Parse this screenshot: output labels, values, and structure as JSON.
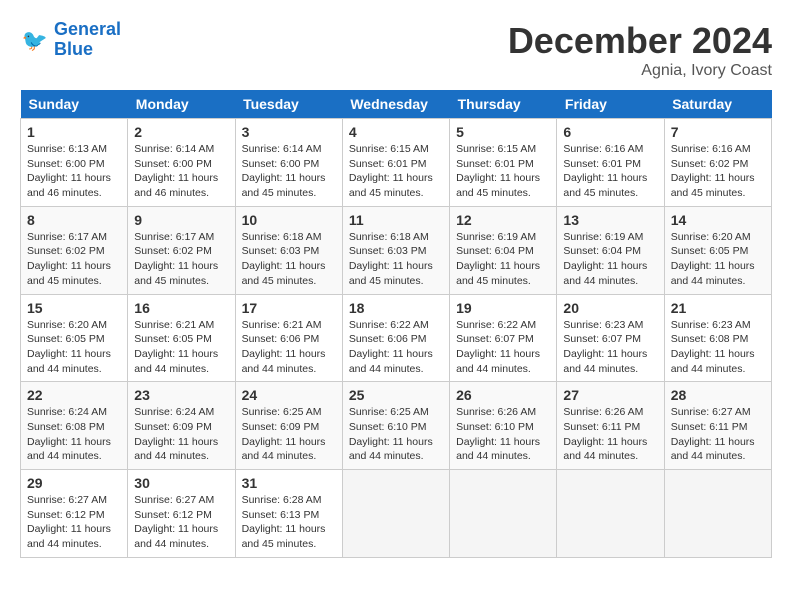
{
  "logo": {
    "line1": "General",
    "line2": "Blue"
  },
  "title": "December 2024",
  "subtitle": "Agnia, Ivory Coast",
  "days_of_week": [
    "Sunday",
    "Monday",
    "Tuesday",
    "Wednesday",
    "Thursday",
    "Friday",
    "Saturday"
  ],
  "weeks": [
    [
      {
        "day": "1",
        "info": "Sunrise: 6:13 AM\nSunset: 6:00 PM\nDaylight: 11 hours\nand 46 minutes."
      },
      {
        "day": "2",
        "info": "Sunrise: 6:14 AM\nSunset: 6:00 PM\nDaylight: 11 hours\nand 46 minutes."
      },
      {
        "day": "3",
        "info": "Sunrise: 6:14 AM\nSunset: 6:00 PM\nDaylight: 11 hours\nand 45 minutes."
      },
      {
        "day": "4",
        "info": "Sunrise: 6:15 AM\nSunset: 6:01 PM\nDaylight: 11 hours\nand 45 minutes."
      },
      {
        "day": "5",
        "info": "Sunrise: 6:15 AM\nSunset: 6:01 PM\nDaylight: 11 hours\nand 45 minutes."
      },
      {
        "day": "6",
        "info": "Sunrise: 6:16 AM\nSunset: 6:01 PM\nDaylight: 11 hours\nand 45 minutes."
      },
      {
        "day": "7",
        "info": "Sunrise: 6:16 AM\nSunset: 6:02 PM\nDaylight: 11 hours\nand 45 minutes."
      }
    ],
    [
      {
        "day": "8",
        "info": "Sunrise: 6:17 AM\nSunset: 6:02 PM\nDaylight: 11 hours\nand 45 minutes."
      },
      {
        "day": "9",
        "info": "Sunrise: 6:17 AM\nSunset: 6:02 PM\nDaylight: 11 hours\nand 45 minutes."
      },
      {
        "day": "10",
        "info": "Sunrise: 6:18 AM\nSunset: 6:03 PM\nDaylight: 11 hours\nand 45 minutes."
      },
      {
        "day": "11",
        "info": "Sunrise: 6:18 AM\nSunset: 6:03 PM\nDaylight: 11 hours\nand 45 minutes."
      },
      {
        "day": "12",
        "info": "Sunrise: 6:19 AM\nSunset: 6:04 PM\nDaylight: 11 hours\nand 45 minutes."
      },
      {
        "day": "13",
        "info": "Sunrise: 6:19 AM\nSunset: 6:04 PM\nDaylight: 11 hours\nand 44 minutes."
      },
      {
        "day": "14",
        "info": "Sunrise: 6:20 AM\nSunset: 6:05 PM\nDaylight: 11 hours\nand 44 minutes."
      }
    ],
    [
      {
        "day": "15",
        "info": "Sunrise: 6:20 AM\nSunset: 6:05 PM\nDaylight: 11 hours\nand 44 minutes."
      },
      {
        "day": "16",
        "info": "Sunrise: 6:21 AM\nSunset: 6:05 PM\nDaylight: 11 hours\nand 44 minutes."
      },
      {
        "day": "17",
        "info": "Sunrise: 6:21 AM\nSunset: 6:06 PM\nDaylight: 11 hours\nand 44 minutes."
      },
      {
        "day": "18",
        "info": "Sunrise: 6:22 AM\nSunset: 6:06 PM\nDaylight: 11 hours\nand 44 minutes."
      },
      {
        "day": "19",
        "info": "Sunrise: 6:22 AM\nSunset: 6:07 PM\nDaylight: 11 hours\nand 44 minutes."
      },
      {
        "day": "20",
        "info": "Sunrise: 6:23 AM\nSunset: 6:07 PM\nDaylight: 11 hours\nand 44 minutes."
      },
      {
        "day": "21",
        "info": "Sunrise: 6:23 AM\nSunset: 6:08 PM\nDaylight: 11 hours\nand 44 minutes."
      }
    ],
    [
      {
        "day": "22",
        "info": "Sunrise: 6:24 AM\nSunset: 6:08 PM\nDaylight: 11 hours\nand 44 minutes."
      },
      {
        "day": "23",
        "info": "Sunrise: 6:24 AM\nSunset: 6:09 PM\nDaylight: 11 hours\nand 44 minutes."
      },
      {
        "day": "24",
        "info": "Sunrise: 6:25 AM\nSunset: 6:09 PM\nDaylight: 11 hours\nand 44 minutes."
      },
      {
        "day": "25",
        "info": "Sunrise: 6:25 AM\nSunset: 6:10 PM\nDaylight: 11 hours\nand 44 minutes."
      },
      {
        "day": "26",
        "info": "Sunrise: 6:26 AM\nSunset: 6:10 PM\nDaylight: 11 hours\nand 44 minutes."
      },
      {
        "day": "27",
        "info": "Sunrise: 6:26 AM\nSunset: 6:11 PM\nDaylight: 11 hours\nand 44 minutes."
      },
      {
        "day": "28",
        "info": "Sunrise: 6:27 AM\nSunset: 6:11 PM\nDaylight: 11 hours\nand 44 minutes."
      }
    ],
    [
      {
        "day": "29",
        "info": "Sunrise: 6:27 AM\nSunset: 6:12 PM\nDaylight: 11 hours\nand 44 minutes."
      },
      {
        "day": "30",
        "info": "Sunrise: 6:27 AM\nSunset: 6:12 PM\nDaylight: 11 hours\nand 44 minutes."
      },
      {
        "day": "31",
        "info": "Sunrise: 6:28 AM\nSunset: 6:13 PM\nDaylight: 11 hours\nand 45 minutes."
      },
      {
        "day": "",
        "info": ""
      },
      {
        "day": "",
        "info": ""
      },
      {
        "day": "",
        "info": ""
      },
      {
        "day": "",
        "info": ""
      }
    ]
  ]
}
